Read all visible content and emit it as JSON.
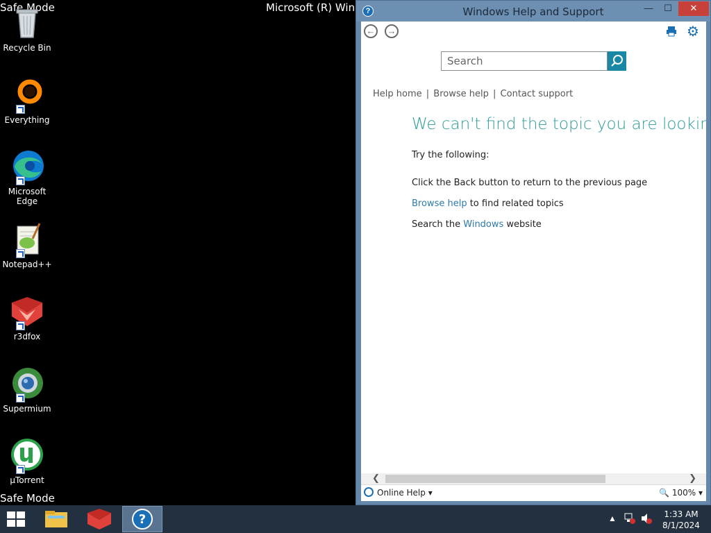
{
  "desktop": {
    "safe_mode_text": "Safe Mode",
    "window_title_behind": "Microsoft (R) Windows",
    "icons": [
      {
        "label": "Recycle Bin"
      },
      {
        "label": "Everything"
      },
      {
        "label": "Microsoft Edge"
      },
      {
        "label": "Notepad++"
      },
      {
        "label": "r3dfox"
      },
      {
        "label": "Supermium"
      },
      {
        "label": "µTorrent"
      }
    ]
  },
  "window": {
    "title": "Windows Help and Support",
    "minimize": "—",
    "maximize": "☐",
    "close": "✕",
    "search_placeholder": "Search",
    "breadcrumbs": {
      "help_home": "Help home",
      "browse_help": "Browse help",
      "contact_support": "Contact support",
      "separator": "|"
    },
    "heading": "We can't find the topic you are looking for",
    "try_following": "Try the following:",
    "line1": "Click the Back button to return to the previous page",
    "line2_link": "Browse help",
    "line2_rest": " to find related topics",
    "line3_pre": "Search the ",
    "line3_link": "Windows",
    "line3_post": " website",
    "status": {
      "online_help": "Online Help",
      "zoom": "100%"
    },
    "colors": {
      "heading": "#2c9c96",
      "link": "#2c7ba8",
      "accent": "#1a87a4"
    }
  },
  "taskbar": {
    "clock_time": "1:33 AM",
    "clock_date": "8/1/2024"
  }
}
